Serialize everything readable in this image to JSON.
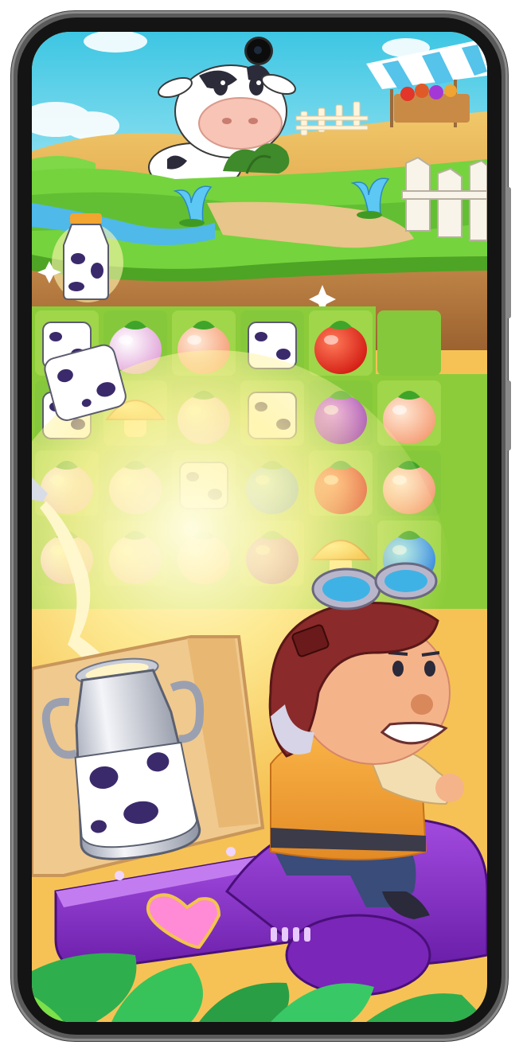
{
  "app": {
    "title": ""
  },
  "scene": {
    "theme_colors": {
      "sky": "#4ccfe6",
      "grass": "#6fcd3b",
      "dirt": "#b57a3e",
      "board_light": "#d6ef72",
      "board_dark": "#b7df55",
      "scooter": "#8a2fc9",
      "jacket": "#f2a23c",
      "milk_can": "#cfd3dd"
    },
    "icons": [
      "cow-icon",
      "milk-bottle-icon",
      "milk-can-icon",
      "fence-icon",
      "blue-flower-icon",
      "fruit-stand-icon",
      "tomato-icon",
      "peach-icon",
      "turnip-icon",
      "eggplant-icon",
      "blueberry-icon",
      "mushroom-icon",
      "cow-block-icon",
      "farmer-character-icon",
      "scooter-icon",
      "heart-icon",
      "sparkle-icon"
    ]
  },
  "board": {
    "rows": [
      [
        "cow-block",
        "turnip",
        "peach",
        "cow-block",
        "tomato",
        ""
      ],
      [
        "cow-block",
        "mushroom",
        "turnip",
        "cow-block",
        "eggplant",
        "peach"
      ],
      [
        "turnip",
        "turnip",
        "cow-block",
        "blueberry",
        "tomato",
        "peach"
      ],
      [
        "turnip",
        "turnip",
        "peach",
        "eggplant",
        "mushroom",
        "blueberry"
      ]
    ]
  }
}
